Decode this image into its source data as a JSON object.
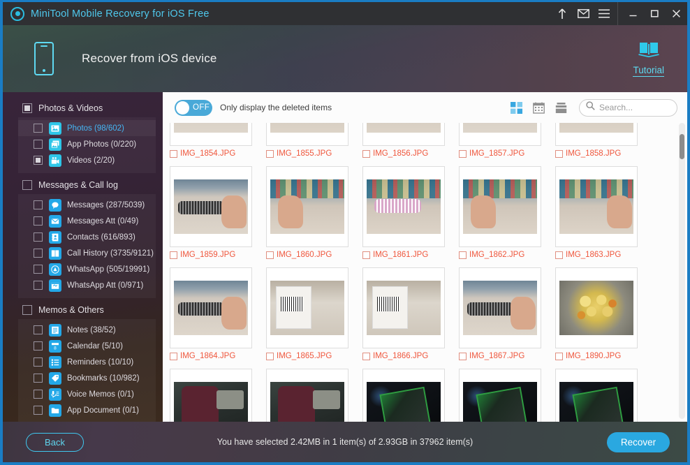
{
  "titlebar": {
    "app_title": "MiniTool Mobile Recovery for iOS Free",
    "buttons": {
      "upgrade": "upgrade-arrow",
      "mail": "mail",
      "menu": "menu",
      "minimize": "minimize",
      "maximize": "maximize",
      "close": "close"
    }
  },
  "header": {
    "title": "Recover from iOS device",
    "tutorial_label": "Tutorial",
    "accent": "#5ddaf0"
  },
  "sidebar": {
    "groups": [
      {
        "label": "Photos & Videos",
        "state": "partial",
        "items": [
          {
            "label": "Photos (98/602)",
            "state": "unchecked",
            "active": true,
            "icon": "photo-icon"
          },
          {
            "label": "App Photos (0/220)",
            "state": "unchecked",
            "active": false,
            "icon": "app-photos-icon"
          },
          {
            "label": "Videos (2/20)",
            "state": "partial",
            "active": false,
            "icon": "video-icon"
          }
        ]
      },
      {
        "label": "Messages & Call log",
        "state": "unchecked",
        "items": [
          {
            "label": "Messages (287/5039)",
            "state": "unchecked",
            "active": false,
            "icon": "message-icon"
          },
          {
            "label": "Messages Att (0/49)",
            "state": "unchecked",
            "active": false,
            "icon": "message-attachment-icon"
          },
          {
            "label": "Contacts (616/893)",
            "state": "unchecked",
            "active": false,
            "icon": "contacts-icon"
          },
          {
            "label": "Call History (3735/9121)",
            "state": "unchecked",
            "active": false,
            "icon": "call-history-icon"
          },
          {
            "label": "WhatsApp (505/19991)",
            "state": "unchecked",
            "active": false,
            "icon": "whatsapp-icon"
          },
          {
            "label": "WhatsApp Att (0/971)",
            "state": "unchecked",
            "active": false,
            "icon": "whatsapp-attachment-icon"
          }
        ]
      },
      {
        "label": "Memos & Others",
        "state": "unchecked",
        "items": [
          {
            "label": "Notes (38/52)",
            "state": "unchecked",
            "active": false,
            "icon": "notes-icon"
          },
          {
            "label": "Calendar (5/10)",
            "state": "unchecked",
            "active": false,
            "icon": "calendar-icon"
          },
          {
            "label": "Reminders (10/10)",
            "state": "unchecked",
            "active": false,
            "icon": "reminders-icon"
          },
          {
            "label": "Bookmarks (10/982)",
            "state": "unchecked",
            "active": false,
            "icon": "bookmarks-icon"
          },
          {
            "label": "Voice Memos (0/1)",
            "state": "unchecked",
            "active": false,
            "icon": "voice-memo-icon"
          },
          {
            "label": "App Document (0/1)",
            "state": "unchecked",
            "active": false,
            "icon": "app-document-icon"
          }
        ]
      }
    ]
  },
  "toolbar": {
    "toggle_state": "OFF",
    "toggle_label": "Only display the deleted items",
    "views": [
      {
        "name": "grid-view",
        "active": true
      },
      {
        "name": "calendar-view",
        "active": false
      },
      {
        "name": "list-view",
        "active": false
      }
    ],
    "search_placeholder": "Search...",
    "search_value": ""
  },
  "grid": {
    "rows": [
      {
        "clipped": true,
        "cells": [
          {
            "filename": "IMG_1854.JPG",
            "art": "ph-brush",
            "checked": false
          },
          {
            "filename": "IMG_1855.JPG",
            "art": "ph-shelf ph-pink",
            "checked": false
          },
          {
            "filename": "IMG_1856.JPG",
            "art": "ph-shelf ph-pink",
            "checked": false
          },
          {
            "filename": "IMG_1857.JPG",
            "art": "ph-brush",
            "checked": false
          },
          {
            "filename": "IMG_1858.JPG",
            "art": "ph-shelf",
            "checked": false
          }
        ]
      },
      {
        "clipped": false,
        "cells": [
          {
            "filename": "IMG_1859.JPG",
            "art": "ph-brush ph-hand",
            "checked": false
          },
          {
            "filename": "IMG_1860.JPG",
            "art": "ph-shelf ph-pink ph-hand",
            "checked": false
          },
          {
            "filename": "IMG_1861.JPG",
            "art": "ph-shelf ph-pink",
            "checked": false
          },
          {
            "filename": "IMG_1862.JPG",
            "art": "ph-shelf ph-pink ph-hand",
            "checked": false
          },
          {
            "filename": "IMG_1863.JPG",
            "art": "ph-shelf ph-hand",
            "checked": false
          }
        ]
      },
      {
        "clipped": false,
        "cells": [
          {
            "filename": "IMG_1864.JPG",
            "art": "ph-brush ph-hand",
            "checked": false
          },
          {
            "filename": "IMG_1865.JPG",
            "art": "ph-label",
            "checked": false
          },
          {
            "filename": "IMG_1866.JPG",
            "art": "ph-label",
            "checked": false
          },
          {
            "filename": "IMG_1867.JPG",
            "art": "ph-brush ph-hand",
            "checked": false
          },
          {
            "filename": "IMG_1890.JPG",
            "art": "ph-lemon",
            "checked": false
          }
        ]
      },
      {
        "clipped": true,
        "cells": [
          {
            "filename": "",
            "art": "ph-room",
            "checked": false
          },
          {
            "filename": "",
            "art": "ph-room",
            "checked": false
          },
          {
            "filename": "",
            "art": "ph-dark ph-case",
            "checked": false
          },
          {
            "filename": "",
            "art": "ph-dark ph-case",
            "checked": false
          },
          {
            "filename": "",
            "art": "ph-dark ph-case",
            "checked": false
          }
        ]
      }
    ]
  },
  "statusbar": {
    "back_label": "Back",
    "status_text": "You have selected 2.42MB in 1 item(s) of 2.93GB in 37962 item(s)",
    "recover_label": "Recover"
  }
}
